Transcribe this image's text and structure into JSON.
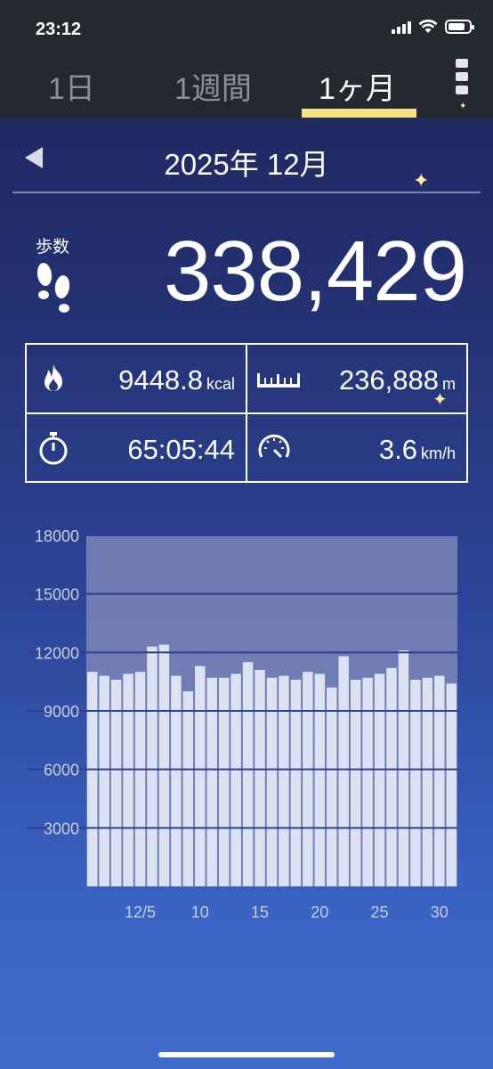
{
  "status_bar": {
    "time": "23:12"
  },
  "tabs": [
    {
      "label": "1日",
      "active": false
    },
    {
      "label": "1週間",
      "active": false
    },
    {
      "label": "1ヶ月",
      "active": true
    }
  ],
  "month_nav": {
    "title": "2025年 12月"
  },
  "steps": {
    "label": "歩数",
    "value": "338,429"
  },
  "stats": {
    "calories": {
      "value": "9448.8",
      "unit": "kcal"
    },
    "distance": {
      "value": "236,888",
      "unit": "m"
    },
    "duration": {
      "value": "65:05:44"
    },
    "speed": {
      "value": "3.6",
      "unit": "km/h"
    }
  },
  "colors": {
    "tab_indicator": "#f4e28a",
    "bar": "#dde2f3",
    "chart_bg": "#7b86b8"
  },
  "chart_data": {
    "type": "bar",
    "ylim": [
      0,
      18000
    ],
    "yticks": [
      "18000",
      "15000",
      "12000",
      "9000",
      "6000",
      "3000"
    ],
    "ytick_values": [
      18000,
      15000,
      12000,
      9000,
      6000,
      3000
    ],
    "xtick_labels": [
      {
        "day": 5,
        "label": "12/5"
      },
      {
        "day": 10,
        "label": "10"
      },
      {
        "day": 15,
        "label": "15"
      },
      {
        "day": 20,
        "label": "20"
      },
      {
        "day": 25,
        "label": "25"
      },
      {
        "day": 30,
        "label": "30"
      }
    ],
    "days": [
      1,
      2,
      3,
      4,
      5,
      6,
      7,
      8,
      9,
      10,
      11,
      12,
      13,
      14,
      15,
      16,
      17,
      18,
      19,
      20,
      21,
      22,
      23,
      24,
      25,
      26,
      27,
      28,
      29,
      30,
      31
    ],
    "values": [
      11000,
      10800,
      10600,
      10900,
      11000,
      12300,
      12400,
      10800,
      10000,
      11300,
      10700,
      10700,
      10900,
      11500,
      11100,
      10700,
      10800,
      10600,
      11000,
      10900,
      10200,
      11800,
      10600,
      10700,
      10900,
      11200,
      12100,
      10600,
      10700,
      10800,
      10400
    ]
  }
}
